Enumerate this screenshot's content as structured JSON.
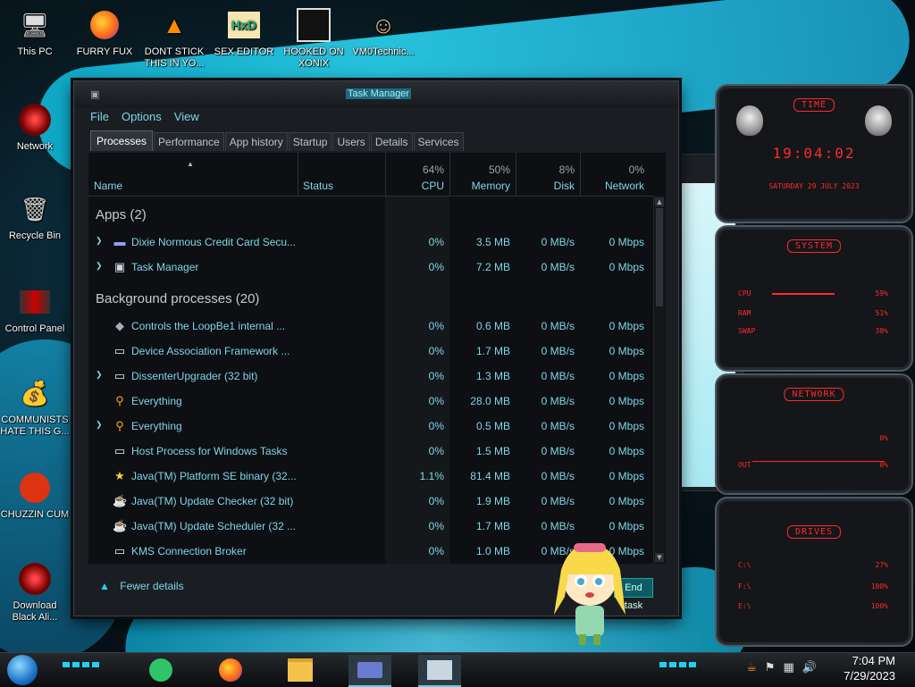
{
  "desktop": {
    "icons_top": [
      {
        "label": "This PC",
        "icon": "computer-icon"
      },
      {
        "label": "FURRY FUX",
        "icon": "firefox-icon"
      },
      {
        "label": "DONT STICK THIS IN YO...",
        "icon": "vlc-icon"
      },
      {
        "label": "SEX EDITOR",
        "icon": "hxd-icon"
      },
      {
        "label": "HOOKED ON XONIX",
        "icon": "game-icon"
      },
      {
        "label": "VM0Technic...",
        "icon": "doctor-icon"
      }
    ],
    "icons_left": [
      {
        "label": "Network",
        "icon": "network-icon"
      },
      {
        "label": "Recycle Bin",
        "icon": "recycle-bin-icon"
      },
      {
        "label": "Control Panel",
        "icon": "control-panel-icon"
      },
      {
        "label": "COMMUNISTS HATE THIS G...",
        "icon": "money-bag-icon"
      },
      {
        "label": "CHUZZIN CUM",
        "icon": "chuzzle-icon"
      },
      {
        "label": "Download Black Ali...",
        "icon": "alien-icon"
      }
    ]
  },
  "task_manager": {
    "title": "Task Manager",
    "menu": [
      "File",
      "Options",
      "View"
    ],
    "tabs": [
      "Processes",
      "Performance",
      "App history",
      "Startup",
      "Users",
      "Details",
      "Services"
    ],
    "active_tab": "Processes",
    "columns": {
      "name": "Name",
      "status": "Status",
      "cpu": {
        "label": "CPU",
        "pct": "64%"
      },
      "memory": {
        "label": "Memory",
        "pct": "50%"
      },
      "disk": {
        "label": "Disk",
        "pct": "8%"
      },
      "network": {
        "label": "Network",
        "pct": "0%"
      }
    },
    "groups": [
      {
        "title": "Apps (2)",
        "rows": [
          {
            "expand": true,
            "icon": "credit-card-icon",
            "name": "Dixie Normous Credit Card Secu...",
            "cpu": "0%",
            "memory": "3.5 MB",
            "disk": "0 MB/s",
            "network": "0 Mbps"
          },
          {
            "expand": true,
            "icon": "task-manager-icon",
            "name": "Task Manager",
            "cpu": "0%",
            "memory": "7.2 MB",
            "disk": "0 MB/s",
            "network": "0 Mbps"
          }
        ]
      },
      {
        "title": "Background processes (20)",
        "rows": [
          {
            "expand": false,
            "icon": "speaker-icon",
            "name": "Controls the LoopBe1 internal ...",
            "cpu": "0%",
            "memory": "0.6 MB",
            "disk": "0 MB/s",
            "network": "0 Mbps"
          },
          {
            "expand": false,
            "icon": "window-icon",
            "name": "Device Association Framework ...",
            "cpu": "0%",
            "memory": "1.7 MB",
            "disk": "0 MB/s",
            "network": "0 Mbps"
          },
          {
            "expand": true,
            "icon": "window-icon",
            "name": "DissenterUpgrader (32 bit)",
            "cpu": "0%",
            "memory": "1.3 MB",
            "disk": "0 MB/s",
            "network": "0 Mbps"
          },
          {
            "expand": false,
            "icon": "magnifier-icon",
            "name": "Everything",
            "cpu": "0%",
            "memory": "28.0 MB",
            "disk": "0 MB/s",
            "network": "0 Mbps"
          },
          {
            "expand": true,
            "icon": "magnifier-icon",
            "name": "Everything",
            "cpu": "0%",
            "memory": "0.5 MB",
            "disk": "0 MB/s",
            "network": "0 Mbps"
          },
          {
            "expand": false,
            "icon": "window-icon",
            "name": "Host Process for Windows Tasks",
            "cpu": "0%",
            "memory": "1.5 MB",
            "disk": "0 MB/s",
            "network": "0 Mbps"
          },
          {
            "expand": false,
            "icon": "star-icon",
            "name": "Java(TM) Platform SE binary (32...",
            "cpu": "1.1%",
            "memory": "81.4 MB",
            "disk": "0 MB/s",
            "network": "0 Mbps"
          },
          {
            "expand": false,
            "icon": "java-icon",
            "name": "Java(TM) Update Checker (32 bit)",
            "cpu": "0%",
            "memory": "1.9 MB",
            "disk": "0 MB/s",
            "network": "0 Mbps"
          },
          {
            "expand": false,
            "icon": "java-icon",
            "name": "Java(TM) Update Scheduler (32 ...",
            "cpu": "0%",
            "memory": "1.7 MB",
            "disk": "0 MB/s",
            "network": "0 Mbps"
          },
          {
            "expand": false,
            "icon": "window-icon",
            "name": "KMS Connection Broker",
            "cpu": "0%",
            "memory": "1.0 MB",
            "disk": "0 MB/s",
            "network": "0 Mbps"
          }
        ]
      }
    ],
    "footer": {
      "fewer_details": "Fewer details",
      "end_task": "End task"
    }
  },
  "rainmeter": {
    "time": {
      "head": "TIME",
      "clock": "19:04:02",
      "date": "SATURDAY 29 JULY 2023"
    },
    "system": {
      "head": "SYSTEM",
      "cpu_label": "CPU",
      "cpu_value": "59%",
      "ram_label": "RAM",
      "ram_value": "51%",
      "swap_label": "SWAP",
      "swap_value": "38%"
    },
    "network": {
      "head": "NETWORK",
      "in_value": "0%",
      "out_label": "OUT",
      "out_value": "0%"
    },
    "drives": {
      "head": "DRIVES",
      "items": [
        {
          "label": "C:\\",
          "value": "27%"
        },
        {
          "label": "F:\\",
          "value": "100%"
        },
        {
          "label": "E:\\",
          "value": "100%"
        }
      ]
    },
    "accent_color": "#ff2a2a"
  },
  "taskbar": {
    "apps": [
      "start-orb-icon",
      "chat-icon",
      "firefox-icon",
      "file-explorer-icon",
      "credit-card-icon",
      "task-manager-icon"
    ],
    "tray_icons": [
      "java-icon",
      "flag-icon",
      "network-icon",
      "volume-icon"
    ],
    "time": "7:04 PM",
    "date": "7/29/2023"
  }
}
